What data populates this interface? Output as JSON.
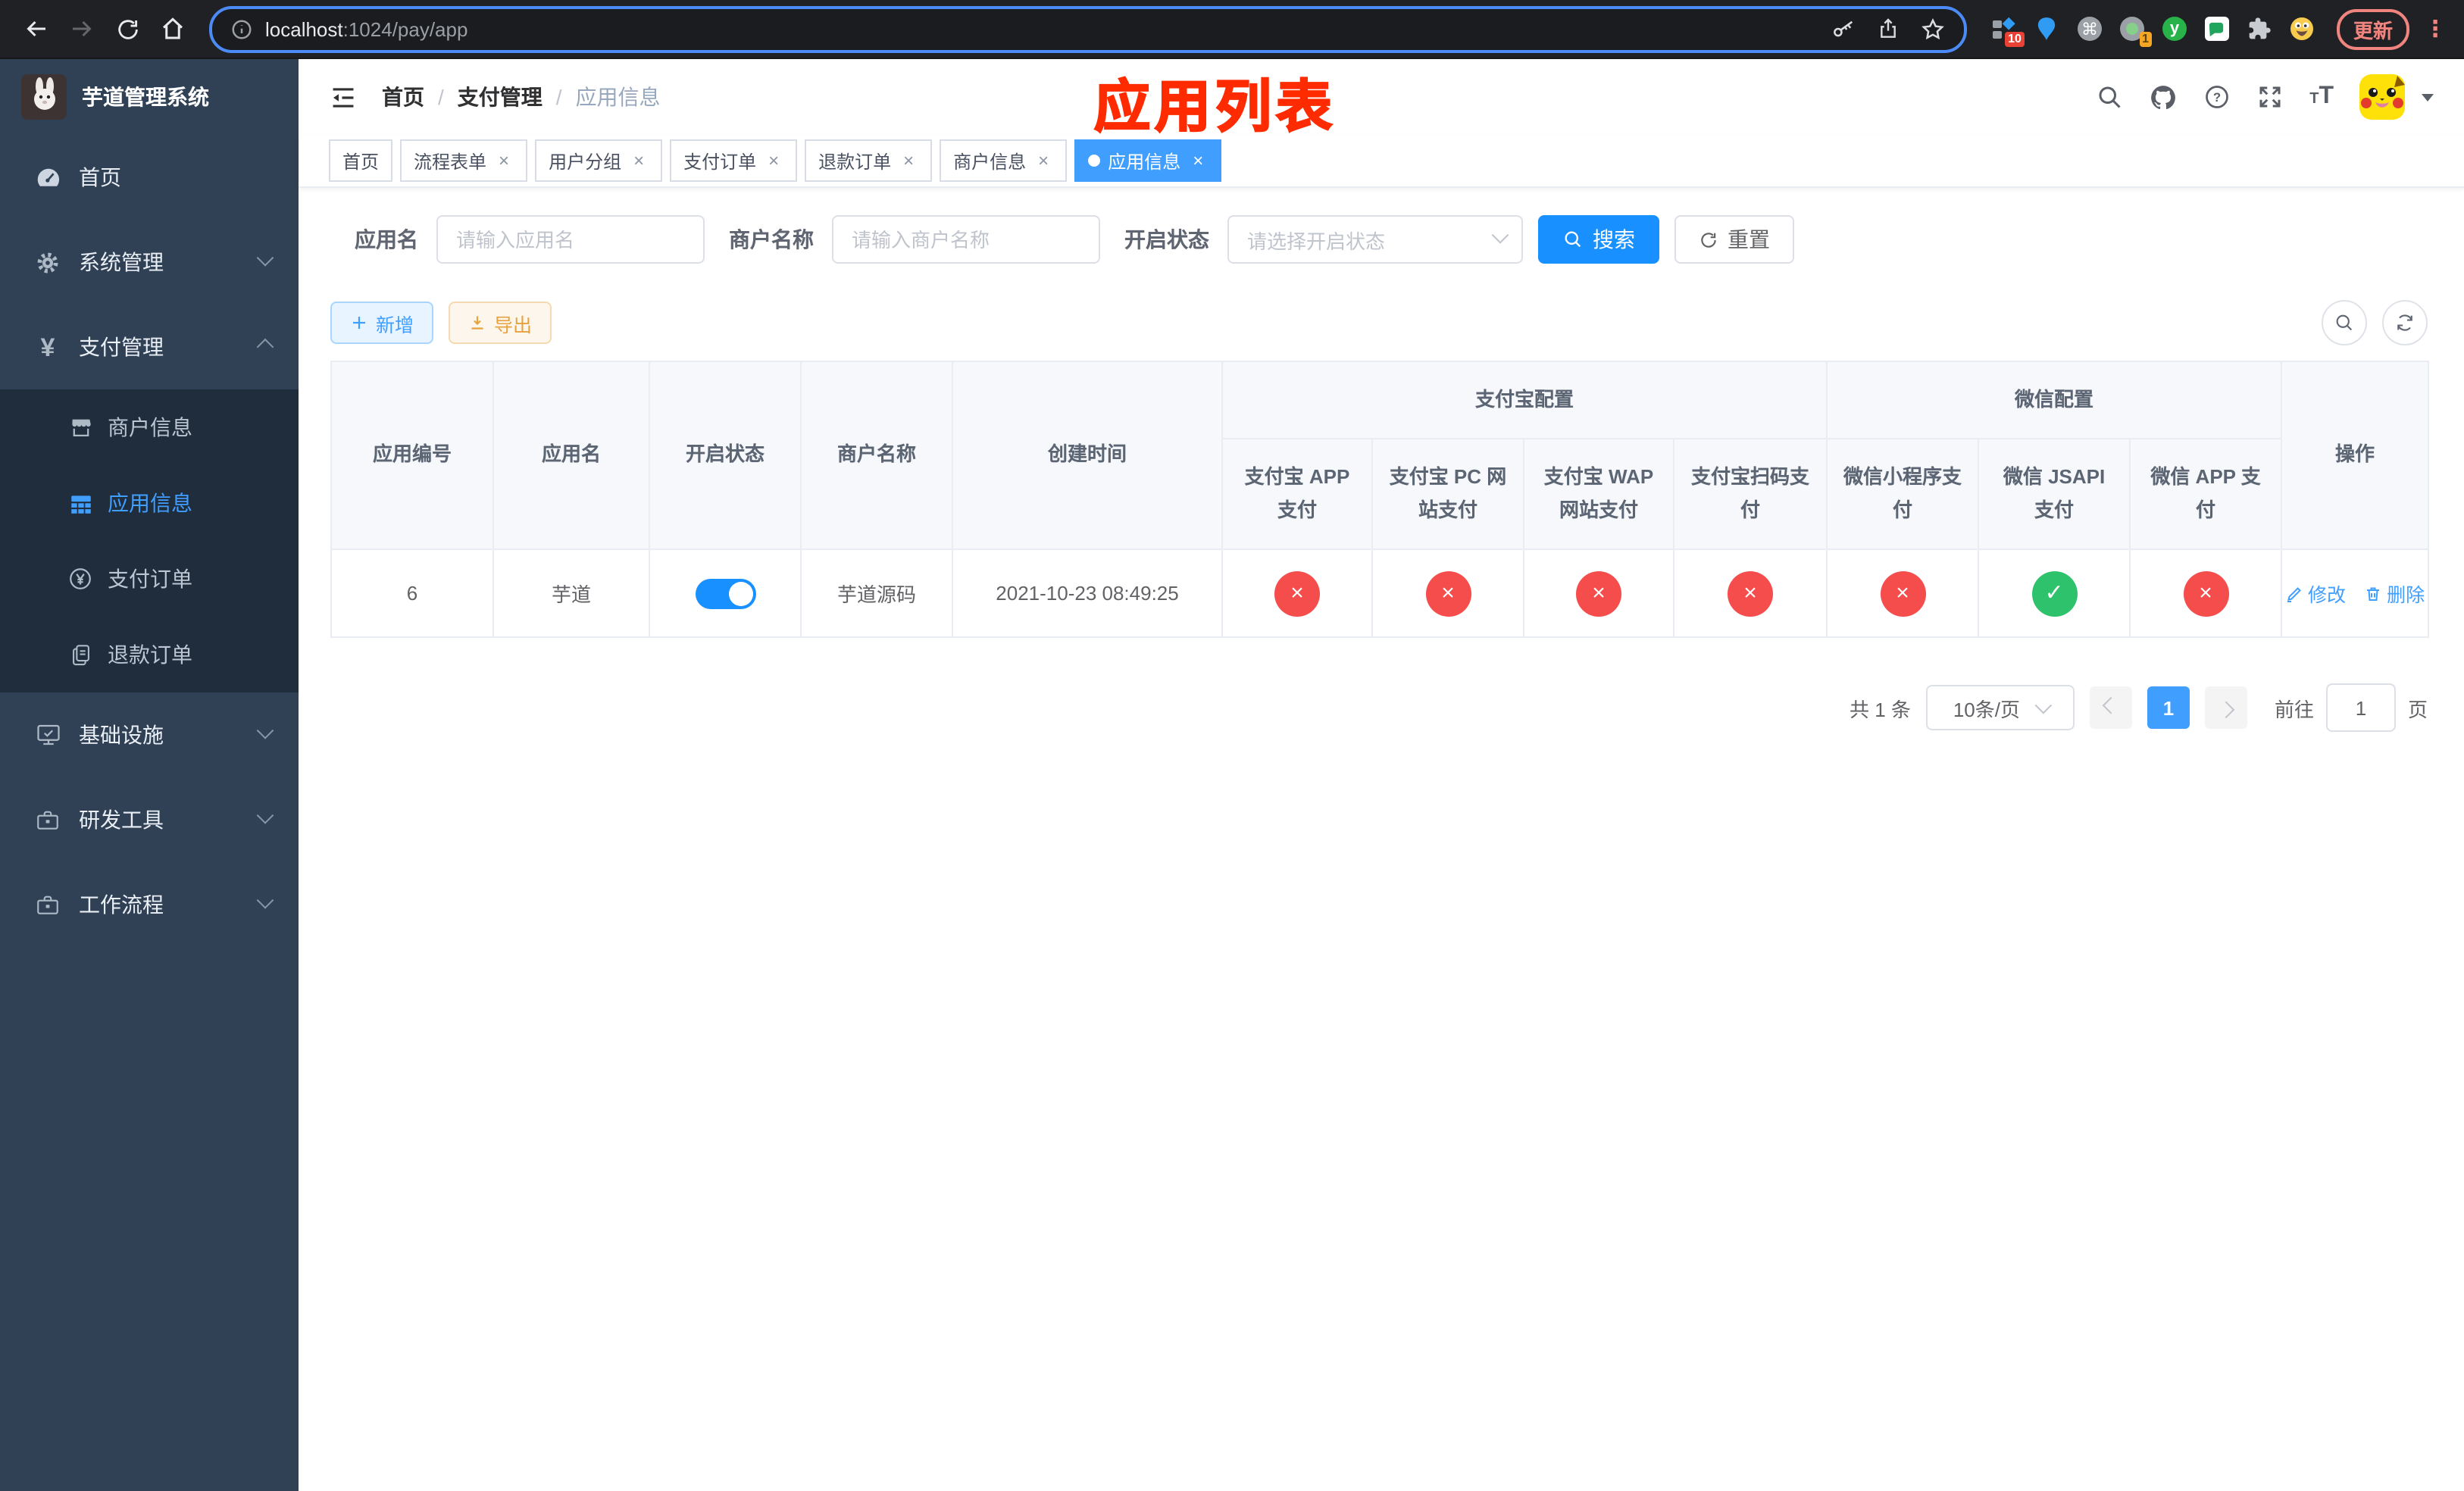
{
  "browser": {
    "url": {
      "host": "localhost",
      "rest": ":1024/pay/app"
    },
    "update_button": "更新",
    "extensions": {
      "badge_a": "10",
      "badge_b": "1",
      "y_letter": "y"
    }
  },
  "app": {
    "logo_title": "芋道管理系统",
    "breadcrumb": {
      "items": [
        "首页",
        "支付管理",
        "应用信息"
      ],
      "separator": "/"
    },
    "annotation": "应用列表",
    "tabs": [
      {
        "label": "首页",
        "closable": false,
        "active": false
      },
      {
        "label": "流程表单",
        "closable": true,
        "active": false
      },
      {
        "label": "用户分组",
        "closable": true,
        "active": false
      },
      {
        "label": "支付订单",
        "closable": true,
        "active": false
      },
      {
        "label": "退款订单",
        "closable": true,
        "active": false
      },
      {
        "label": "商户信息",
        "closable": true,
        "active": false
      },
      {
        "label": "应用信息",
        "closable": true,
        "active": true
      }
    ]
  },
  "sidebar": {
    "items": [
      {
        "label": "首页"
      },
      {
        "label": "系统管理"
      },
      {
        "label": "支付管理"
      },
      {
        "label": "商户信息"
      },
      {
        "label": "应用信息"
      },
      {
        "label": "支付订单"
      },
      {
        "label": "退款订单"
      },
      {
        "label": "基础设施"
      },
      {
        "label": "研发工具"
      },
      {
        "label": "工作流程"
      }
    ]
  },
  "filters": {
    "app_name": {
      "label": "应用名",
      "placeholder": "请输入应用名"
    },
    "merchant_name": {
      "label": "商户名称",
      "placeholder": "请输入商户名称"
    },
    "status": {
      "label": "开启状态",
      "placeholder": "请选择开启状态"
    },
    "search": "搜索",
    "reset": "重置"
  },
  "toolbar": {
    "add": "新增",
    "export": "导出"
  },
  "table": {
    "simple_columns": [
      "应用编号",
      "应用名",
      "开启状态",
      "商户名称",
      "创建时间"
    ],
    "groups": [
      {
        "label": "支付宝配置",
        "children": [
          "支付宝 APP 支付",
          "支付宝 PC 网站支付",
          "支付宝 WAP 网站支付",
          "支付宝扫码支付"
        ]
      },
      {
        "label": "微信配置",
        "children": [
          "微信小程序支付",
          "微信 JSAPI 支付",
          "微信 APP 支付"
        ]
      }
    ],
    "action_column": "操作",
    "row": {
      "id": "6",
      "name": "芋道",
      "enabled": true,
      "merchant": "芋道源码",
      "created_at": "2021-10-23 08:49:25",
      "statuses": [
        "fail",
        "fail",
        "fail",
        "fail",
        "fail",
        "pass",
        "fail"
      ],
      "edit": "修改",
      "delete": "删除"
    }
  },
  "pagination": {
    "total": "共 1 条",
    "page_size": "10条/页",
    "current_page": "1",
    "goto_label": "前往",
    "goto_value": "1",
    "page_unit": "页"
  },
  "icons": {
    "slash": "/",
    "close": "×",
    "check": "✓",
    "cross": "×",
    "kebab": "⋮",
    "command": "⌘",
    "question": "?",
    "yen": "¥",
    "text_size": "TT"
  },
  "colors": {
    "primary": "#409eff",
    "search_blue": "#1890ff",
    "fail_red": "#f54c4c",
    "pass_green": "#2dc26b",
    "annotation_red": "#ff2b00",
    "sidebar_bg": "#304156",
    "submenu_bg": "#1f2d3d",
    "tag_active": "#409eff"
  }
}
